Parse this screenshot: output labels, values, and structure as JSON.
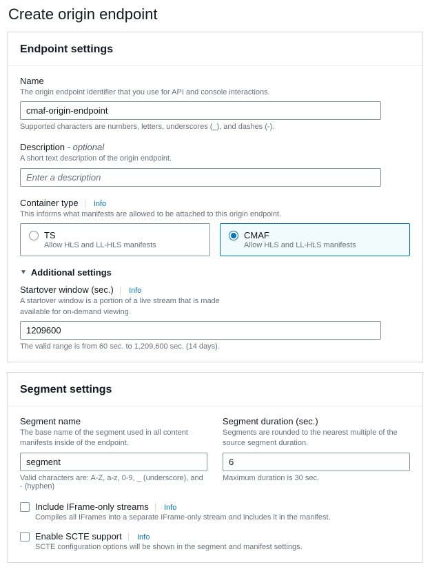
{
  "page_title": "Create origin endpoint",
  "info_label": "Info",
  "endpoint_settings": {
    "heading": "Endpoint settings",
    "name": {
      "label": "Name",
      "desc": "The origin endpoint identifier that you use for API and console interactions.",
      "value": "cmaf-origin-endpoint",
      "hint": "Supported characters are numbers, letters, underscores (_), and dashes (-)."
    },
    "description": {
      "label": "Description",
      "optional": " - optional",
      "desc": "A short text description of the origin endpoint.",
      "placeholder": "Enter a description",
      "value": ""
    },
    "container_type": {
      "label": "Container type",
      "desc": "This informs what manifests are allowed to be attached to this origin endpoint.",
      "options": {
        "ts": {
          "title": "TS",
          "desc": "Allow HLS and LL-HLS manifests"
        },
        "cmaf": {
          "title": "CMAF",
          "desc": "Allow HLS and LL-HLS manifests"
        }
      }
    },
    "additional": {
      "title": "Additional settings",
      "startover": {
        "label": "Startover window (sec.)",
        "desc": "A startover window is a portion of a live stream that is made available for on-demand viewing.",
        "value": "1209600",
        "hint": "The valid range is from 60 sec. to 1,209,600 sec. (14 days)."
      }
    }
  },
  "segment_settings": {
    "heading": "Segment settings",
    "segment_name": {
      "label": "Segment name",
      "desc": "The base name of the segment used in all content manifests inside of the endpoint.",
      "value": "segment",
      "hint": "Valid characters are: A-Z, a-z, 0-9, _ (underscore), and - (hyphen)"
    },
    "segment_duration": {
      "label": "Segment duration (sec.)",
      "desc": "Segments are rounded to the nearest multiple of the source segment duration.",
      "value": "6",
      "hint": "Maximum duration is 30 sec."
    },
    "iframe": {
      "label": "Include IFrame-only streams",
      "desc": "Compiles all IFrames into a separate IFrame-only stream and includes it in the manifest."
    },
    "scte": {
      "label": "Enable SCTE support",
      "desc": "SCTE configuration options will be shown in the segment and manifest settings."
    }
  }
}
